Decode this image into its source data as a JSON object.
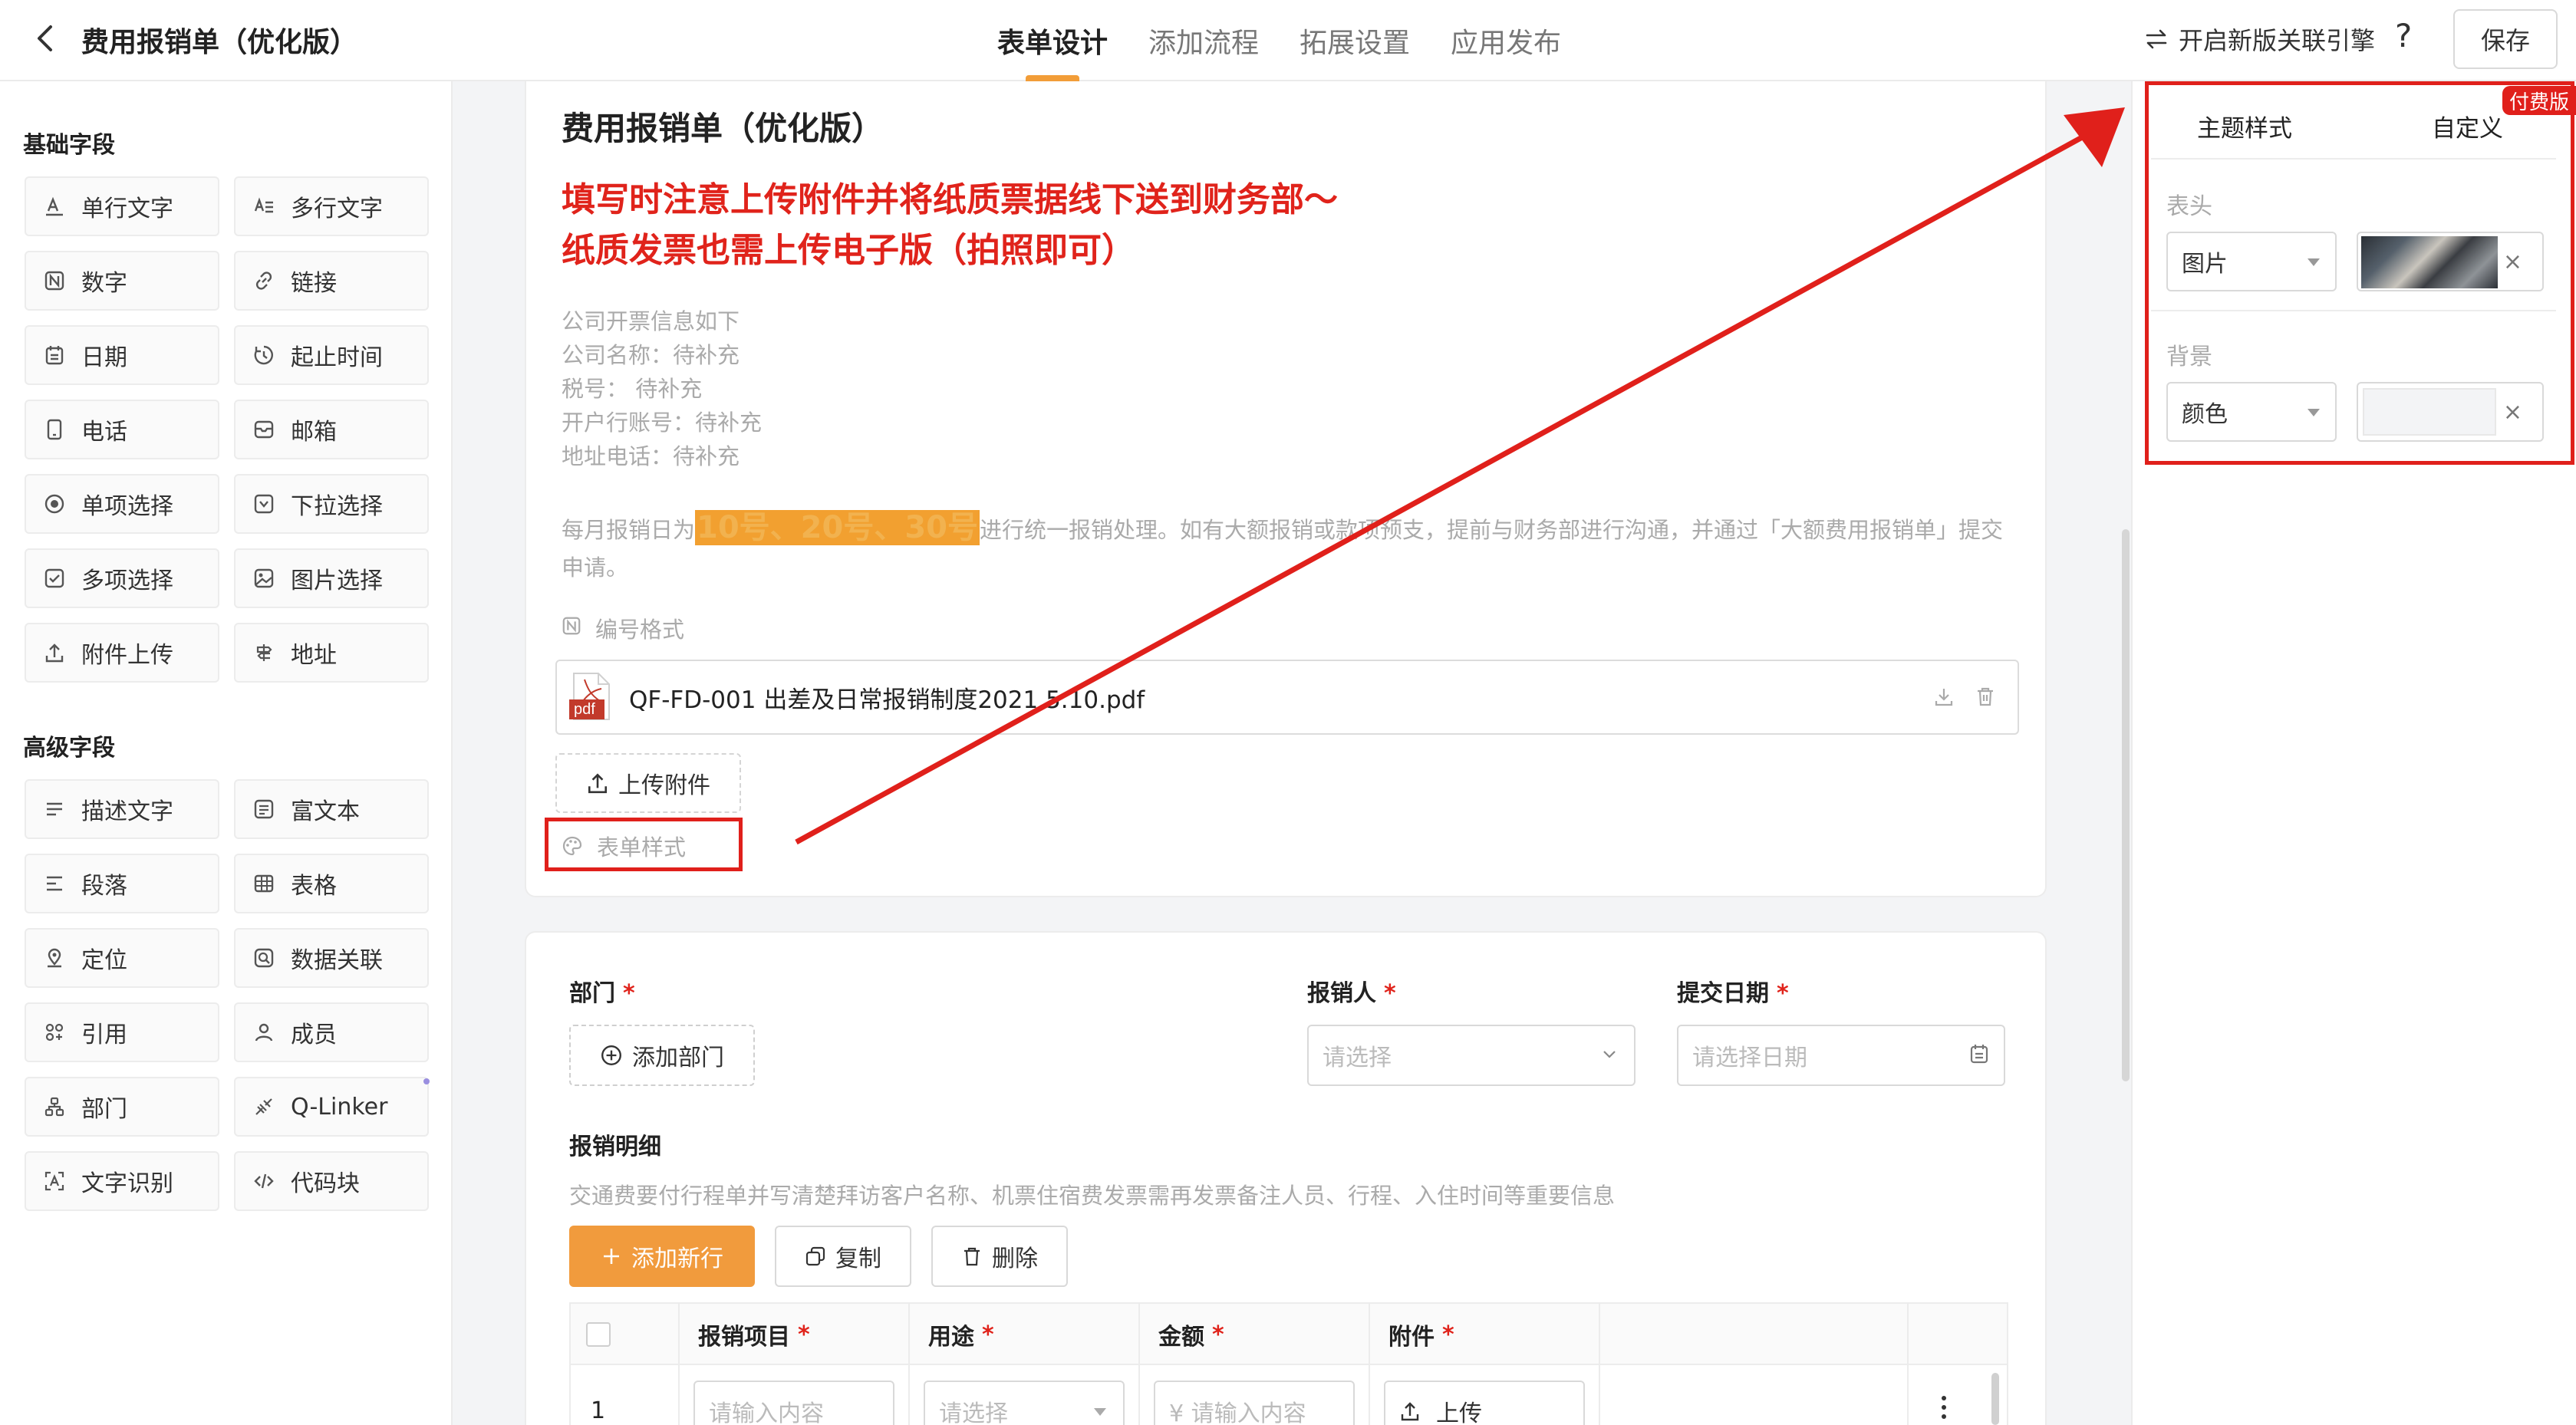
{
  "header": {
    "back_icon": "chevron-left-icon",
    "title": "费用报销单（优化版）",
    "tabs": [
      {
        "label": "表单设计",
        "active": true
      },
      {
        "label": "添加流程",
        "active": false
      },
      {
        "label": "拓展设置",
        "active": false
      },
      {
        "label": "应用发布",
        "active": false
      }
    ],
    "engine_label": "开启新版关联引擎",
    "help_label": "?",
    "save_label": "保存",
    "accent_color": "#f29d38"
  },
  "palette": {
    "basic_title": "基础字段",
    "basic": [
      {
        "label": "单行文字",
        "icon": "single-text-icon"
      },
      {
        "label": "多行文字",
        "icon": "multi-text-icon"
      },
      {
        "label": "数字",
        "icon": "number-icon"
      },
      {
        "label": "链接",
        "icon": "link-icon"
      },
      {
        "label": "日期",
        "icon": "calendar-icon"
      },
      {
        "label": "起止时间",
        "icon": "clock-icon"
      },
      {
        "label": "电话",
        "icon": "phone-icon"
      },
      {
        "label": "邮箱",
        "icon": "mail-icon"
      },
      {
        "label": "单项选择",
        "icon": "radio-icon"
      },
      {
        "label": "下拉选择",
        "icon": "dropdown-icon"
      },
      {
        "label": "多项选择",
        "icon": "checkbox-icon"
      },
      {
        "label": "图片选择",
        "icon": "image-icon"
      },
      {
        "label": "附件上传",
        "icon": "upload-icon"
      },
      {
        "label": "地址",
        "icon": "signpost-icon"
      }
    ],
    "advanced_title": "高级字段",
    "advanced": [
      {
        "label": "描述文字",
        "icon": "description-icon"
      },
      {
        "label": "富文本",
        "icon": "rich-text-icon"
      },
      {
        "label": "段落",
        "icon": "paragraph-icon"
      },
      {
        "label": "表格",
        "icon": "table-icon"
      },
      {
        "label": "定位",
        "icon": "location-icon"
      },
      {
        "label": "数据关联",
        "icon": "data-link-icon"
      },
      {
        "label": "引用",
        "icon": "reference-icon"
      },
      {
        "label": "成员",
        "icon": "user-icon"
      },
      {
        "label": "部门",
        "icon": "department-icon"
      },
      {
        "label": "Q-Linker",
        "icon": "q-linker-icon"
      },
      {
        "label": "文字识别",
        "icon": "ocr-icon"
      },
      {
        "label": "代码块",
        "icon": "code-icon"
      }
    ]
  },
  "form": {
    "title": "费用报销单（优化版）",
    "notice_line1": "填写时注意上传附件并将纸质票据线下送到财务部～",
    "notice_line2": "纸质发票也需上传电子版（拍照即可）",
    "info_lines": [
      "公司开票信息如下",
      "公司名称：待补充",
      "税号： 待补充",
      "开户行账号：待补充",
      "地址电话：待补充"
    ],
    "para_prefix": "每月报销日为",
    "para_highlight": "10号、20号、30号",
    "para_suffix": "进行统一报销处理。如有大额报销或款项预支，提前与财务部进行沟通，并通过「大额费用报销单」提交申请。",
    "number_format_label": "编号格式",
    "attachment": {
      "badge": "pdf",
      "name": "QF-FD-001 出差及日常报销制度2021.5.10.pdf"
    },
    "upload_label": "上传附件",
    "form_style_label": "表单样式"
  },
  "fields": {
    "department_label": "部门",
    "add_department": "添加部门",
    "reimburser_label": "报销人",
    "reimburser_placeholder": "请选择",
    "date_label": "提交日期",
    "date_placeholder": "请选择日期",
    "required_mark": "*",
    "detail_title": "报销明细",
    "detail_hint": "交通费要付行程单并写清楚拜访客户名称、机票住宿费发票需再发票备注人员、行程、入住时间等重要信息",
    "add_row": "添加新行",
    "copy": "复制",
    "delete": "删除",
    "columns": [
      "报销项目",
      "用途",
      "金额",
      "附件"
    ],
    "row_number": "1",
    "item_placeholder": "请输入内容",
    "purpose_placeholder": "请选择",
    "amount_placeholder": "¥ 请输入内容",
    "upload_cell": "上传"
  },
  "right_panel": {
    "tab_theme": "主题样式",
    "tab_custom": "自定义",
    "paid_badge": "付费版",
    "header_label": "表头",
    "header_type": "图片",
    "background_label": "背景",
    "background_type": "颜色",
    "background_color": "#f3f4f6",
    "clear_label": "×"
  },
  "annotation_color": "#e0201b"
}
